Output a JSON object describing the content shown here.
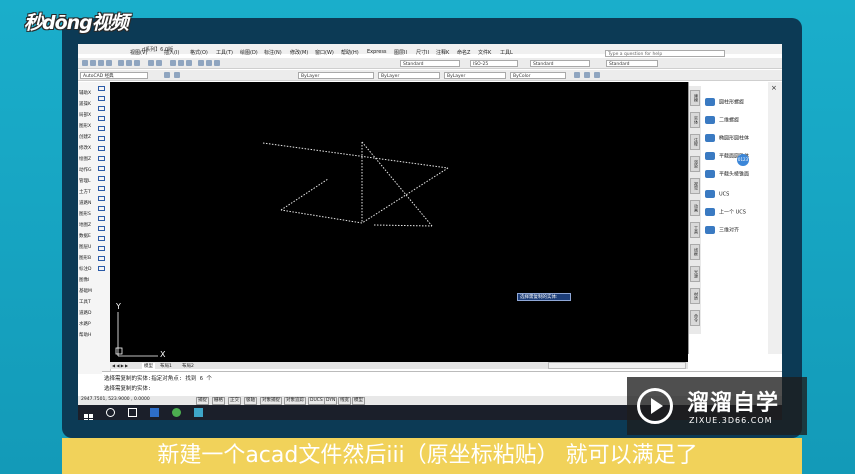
{
  "brand": {
    "logo": "秒dōng视频"
  },
  "window": {
    "title_fragment": "AutoCAD 经典 - [Drawing1.dwg]",
    "title_prefix": "d系列】6.0版",
    "menus": [
      "视图(V)",
      "插入(I)",
      "格式(O)",
      "工具(T)",
      "绘图(D)",
      "标注(N)",
      "修改(M)",
      "窗口(W)",
      "帮助(H)",
      "Express",
      "图层II",
      "尺寸II",
      "注释K",
      "命名Z",
      "文件K",
      "工具L"
    ],
    "help_placeholder": "Type a question for help"
  },
  "toolbar": {
    "workspace": "AutoCAD 经典",
    "text_style": "Standard",
    "dim_style": "ISO-25",
    "table_style": "Standard",
    "multileader_style": "Standard",
    "layer": "ByLayer",
    "linetype": "ByLayer",
    "lineweight": "ByLayer",
    "color": "ByColor"
  },
  "left_panel": {
    "items": [
      "辅助X",
      "遥操K",
      "局部X",
      "图形X",
      "创建Z",
      "修改X",
      "绘图Z",
      "动作G",
      "管理L",
      "土方T",
      "道路N",
      "图形S",
      "地图Z",
      "数据E",
      "图层U",
      "图形B",
      "标注D",
      "图像I",
      "基础M",
      "工具T",
      "道路D",
      "水路P",
      "帮助H"
    ]
  },
  "canvas": {
    "ucs_x": "X",
    "ucs_y": "Y",
    "tooltip": "选择需复制的实体:"
  },
  "layout_tabs": {
    "model": "模型",
    "layout1": "布局1",
    "layout2": "布局2"
  },
  "palette": {
    "tabs": [
      "建模",
      "实体",
      "注释",
      "渲染",
      "视觉",
      "动画",
      "工具",
      "线框",
      "光源",
      "材质",
      "命令"
    ],
    "items": [
      {
        "icon": "helix-icon",
        "label": "圆柱形螺旋"
      },
      {
        "icon": "spiral-icon",
        "label": "二维螺旋"
      },
      {
        "icon": "cylinder-icon",
        "label": "椭圆形圆柱体"
      },
      {
        "icon": "cone-icon",
        "label": "平截面圆锥体"
      },
      {
        "icon": "pyramid-icon",
        "label": "平截头棱锥面"
      },
      {
        "icon": "ucs-icon",
        "label": "UCS"
      },
      {
        "icon": "ucs-prev-icon",
        "label": "上一个 UCS"
      },
      {
        "icon": "3d-align-icon",
        "label": "三维对齐"
      }
    ],
    "badge": "0123"
  },
  "command": {
    "line1": "选择需复制的实体:指定对角点: 找到 6 个",
    "line2": "选择需复制的实体:"
  },
  "status": {
    "coords": "2947.7501, 523.9000 , 0.0000",
    "toggles": [
      "捕捉",
      "栅格",
      "正交",
      "极轴",
      "对象捕捉",
      "对象追踪",
      "DUCS",
      "DYN",
      "线宽",
      "模型"
    ]
  },
  "subtitle": "新建一个acad文件然后iii（原坐标粘贴） 就可以满足了",
  "watermark": {
    "name": "溜溜自学",
    "url": "ZIXUE.3D66.COM"
  }
}
